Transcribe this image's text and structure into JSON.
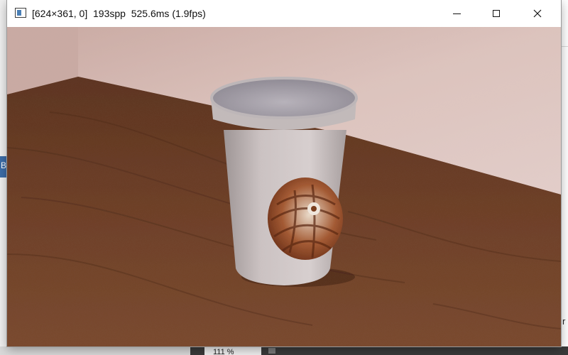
{
  "window": {
    "title": "[624×361, 0]  193spp  525.6ms (1.9fps)",
    "controls": [
      "minimize",
      "maximize",
      "close"
    ]
  },
  "render": {
    "resolution": "624×361",
    "frame_index": 0,
    "samples_per_pixel": 193,
    "frame_time_ms": 525.6,
    "fps": 1.9,
    "scene_objects": [
      "wall",
      "wooden-table",
      "paper-cup",
      "nautilus-shell-print"
    ]
  },
  "background": {
    "zoom_label": "111 %",
    "left_fragment": "B",
    "right_fragment": "r"
  },
  "colors": {
    "titlebar": "#ffffff",
    "wall": "#d9bfb8",
    "table": "#6b3d25",
    "cup": "#cfc7c7"
  }
}
